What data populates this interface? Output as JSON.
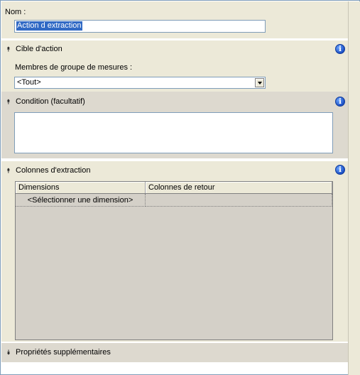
{
  "nom": {
    "label": "Nom :",
    "value": "Action d extraction"
  },
  "cible": {
    "title": "Cible d'action",
    "group_label": "Membres de groupe de mesures :",
    "group_value": "<Tout>"
  },
  "condition": {
    "title": "Condition (facultatif)",
    "value": ""
  },
  "colonnes": {
    "title": "Colonnes d'extraction",
    "headers": [
      "Dimensions",
      "Colonnes de retour"
    ],
    "rows": [
      {
        "dimension": "<Sélectionner une dimension>",
        "retour": ""
      }
    ]
  },
  "proprietes": {
    "title": "Propriétés supplémentaires"
  },
  "icons": {
    "collapse": "chevron-double-up-icon",
    "expand": "chevron-double-down-icon",
    "info": "info-icon"
  },
  "colors": {
    "selection": "#316ac5",
    "panel": "#ece9d8",
    "info": "#1b4fc4"
  }
}
